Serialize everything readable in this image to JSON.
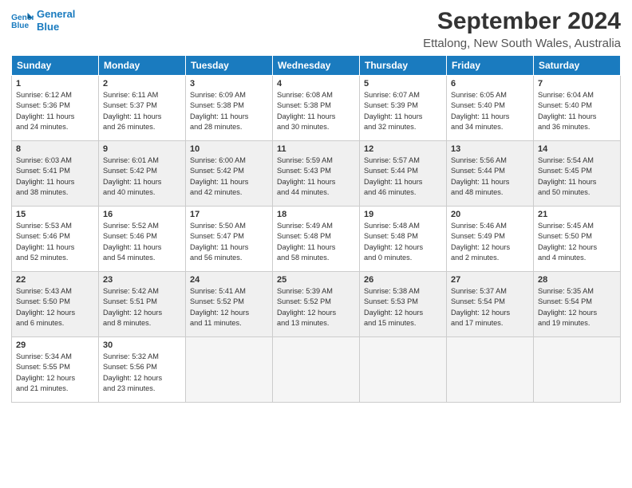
{
  "logo": {
    "line1": "General",
    "line2": "Blue"
  },
  "title": "September 2024",
  "location": "Ettalong, New South Wales, Australia",
  "headers": [
    "Sunday",
    "Monday",
    "Tuesday",
    "Wednesday",
    "Thursday",
    "Friday",
    "Saturday"
  ],
  "weeks": [
    [
      {
        "day": "1",
        "lines": [
          "Sunrise: 6:12 AM",
          "Sunset: 5:36 PM",
          "Daylight: 11 hours",
          "and 24 minutes."
        ]
      },
      {
        "day": "2",
        "lines": [
          "Sunrise: 6:11 AM",
          "Sunset: 5:37 PM",
          "Daylight: 11 hours",
          "and 26 minutes."
        ]
      },
      {
        "day": "3",
        "lines": [
          "Sunrise: 6:09 AM",
          "Sunset: 5:38 PM",
          "Daylight: 11 hours",
          "and 28 minutes."
        ]
      },
      {
        "day": "4",
        "lines": [
          "Sunrise: 6:08 AM",
          "Sunset: 5:38 PM",
          "Daylight: 11 hours",
          "and 30 minutes."
        ]
      },
      {
        "day": "5",
        "lines": [
          "Sunrise: 6:07 AM",
          "Sunset: 5:39 PM",
          "Daylight: 11 hours",
          "and 32 minutes."
        ]
      },
      {
        "day": "6",
        "lines": [
          "Sunrise: 6:05 AM",
          "Sunset: 5:40 PM",
          "Daylight: 11 hours",
          "and 34 minutes."
        ]
      },
      {
        "day": "7",
        "lines": [
          "Sunrise: 6:04 AM",
          "Sunset: 5:40 PM",
          "Daylight: 11 hours",
          "and 36 minutes."
        ]
      }
    ],
    [
      {
        "day": "8",
        "lines": [
          "Sunrise: 6:03 AM",
          "Sunset: 5:41 PM",
          "Daylight: 11 hours",
          "and 38 minutes."
        ]
      },
      {
        "day": "9",
        "lines": [
          "Sunrise: 6:01 AM",
          "Sunset: 5:42 PM",
          "Daylight: 11 hours",
          "and 40 minutes."
        ]
      },
      {
        "day": "10",
        "lines": [
          "Sunrise: 6:00 AM",
          "Sunset: 5:42 PM",
          "Daylight: 11 hours",
          "and 42 minutes."
        ]
      },
      {
        "day": "11",
        "lines": [
          "Sunrise: 5:59 AM",
          "Sunset: 5:43 PM",
          "Daylight: 11 hours",
          "and 44 minutes."
        ]
      },
      {
        "day": "12",
        "lines": [
          "Sunrise: 5:57 AM",
          "Sunset: 5:44 PM",
          "Daylight: 11 hours",
          "and 46 minutes."
        ]
      },
      {
        "day": "13",
        "lines": [
          "Sunrise: 5:56 AM",
          "Sunset: 5:44 PM",
          "Daylight: 11 hours",
          "and 48 minutes."
        ]
      },
      {
        "day": "14",
        "lines": [
          "Sunrise: 5:54 AM",
          "Sunset: 5:45 PM",
          "Daylight: 11 hours",
          "and 50 minutes."
        ]
      }
    ],
    [
      {
        "day": "15",
        "lines": [
          "Sunrise: 5:53 AM",
          "Sunset: 5:46 PM",
          "Daylight: 11 hours",
          "and 52 minutes."
        ]
      },
      {
        "day": "16",
        "lines": [
          "Sunrise: 5:52 AM",
          "Sunset: 5:46 PM",
          "Daylight: 11 hours",
          "and 54 minutes."
        ]
      },
      {
        "day": "17",
        "lines": [
          "Sunrise: 5:50 AM",
          "Sunset: 5:47 PM",
          "Daylight: 11 hours",
          "and 56 minutes."
        ]
      },
      {
        "day": "18",
        "lines": [
          "Sunrise: 5:49 AM",
          "Sunset: 5:48 PM",
          "Daylight: 11 hours",
          "and 58 minutes."
        ]
      },
      {
        "day": "19",
        "lines": [
          "Sunrise: 5:48 AM",
          "Sunset: 5:48 PM",
          "Daylight: 12 hours",
          "and 0 minutes."
        ]
      },
      {
        "day": "20",
        "lines": [
          "Sunrise: 5:46 AM",
          "Sunset: 5:49 PM",
          "Daylight: 12 hours",
          "and 2 minutes."
        ]
      },
      {
        "day": "21",
        "lines": [
          "Sunrise: 5:45 AM",
          "Sunset: 5:50 PM",
          "Daylight: 12 hours",
          "and 4 minutes."
        ]
      }
    ],
    [
      {
        "day": "22",
        "lines": [
          "Sunrise: 5:43 AM",
          "Sunset: 5:50 PM",
          "Daylight: 12 hours",
          "and 6 minutes."
        ]
      },
      {
        "day": "23",
        "lines": [
          "Sunrise: 5:42 AM",
          "Sunset: 5:51 PM",
          "Daylight: 12 hours",
          "and 8 minutes."
        ]
      },
      {
        "day": "24",
        "lines": [
          "Sunrise: 5:41 AM",
          "Sunset: 5:52 PM",
          "Daylight: 12 hours",
          "and 11 minutes."
        ]
      },
      {
        "day": "25",
        "lines": [
          "Sunrise: 5:39 AM",
          "Sunset: 5:52 PM",
          "Daylight: 12 hours",
          "and 13 minutes."
        ]
      },
      {
        "day": "26",
        "lines": [
          "Sunrise: 5:38 AM",
          "Sunset: 5:53 PM",
          "Daylight: 12 hours",
          "and 15 minutes."
        ]
      },
      {
        "day": "27",
        "lines": [
          "Sunrise: 5:37 AM",
          "Sunset: 5:54 PM",
          "Daylight: 12 hours",
          "and 17 minutes."
        ]
      },
      {
        "day": "28",
        "lines": [
          "Sunrise: 5:35 AM",
          "Sunset: 5:54 PM",
          "Daylight: 12 hours",
          "and 19 minutes."
        ]
      }
    ],
    [
      {
        "day": "29",
        "lines": [
          "Sunrise: 5:34 AM",
          "Sunset: 5:55 PM",
          "Daylight: 12 hours",
          "and 21 minutes."
        ]
      },
      {
        "day": "30",
        "lines": [
          "Sunrise: 5:32 AM",
          "Sunset: 5:56 PM",
          "Daylight: 12 hours",
          "and 23 minutes."
        ]
      },
      null,
      null,
      null,
      null,
      null
    ]
  ]
}
